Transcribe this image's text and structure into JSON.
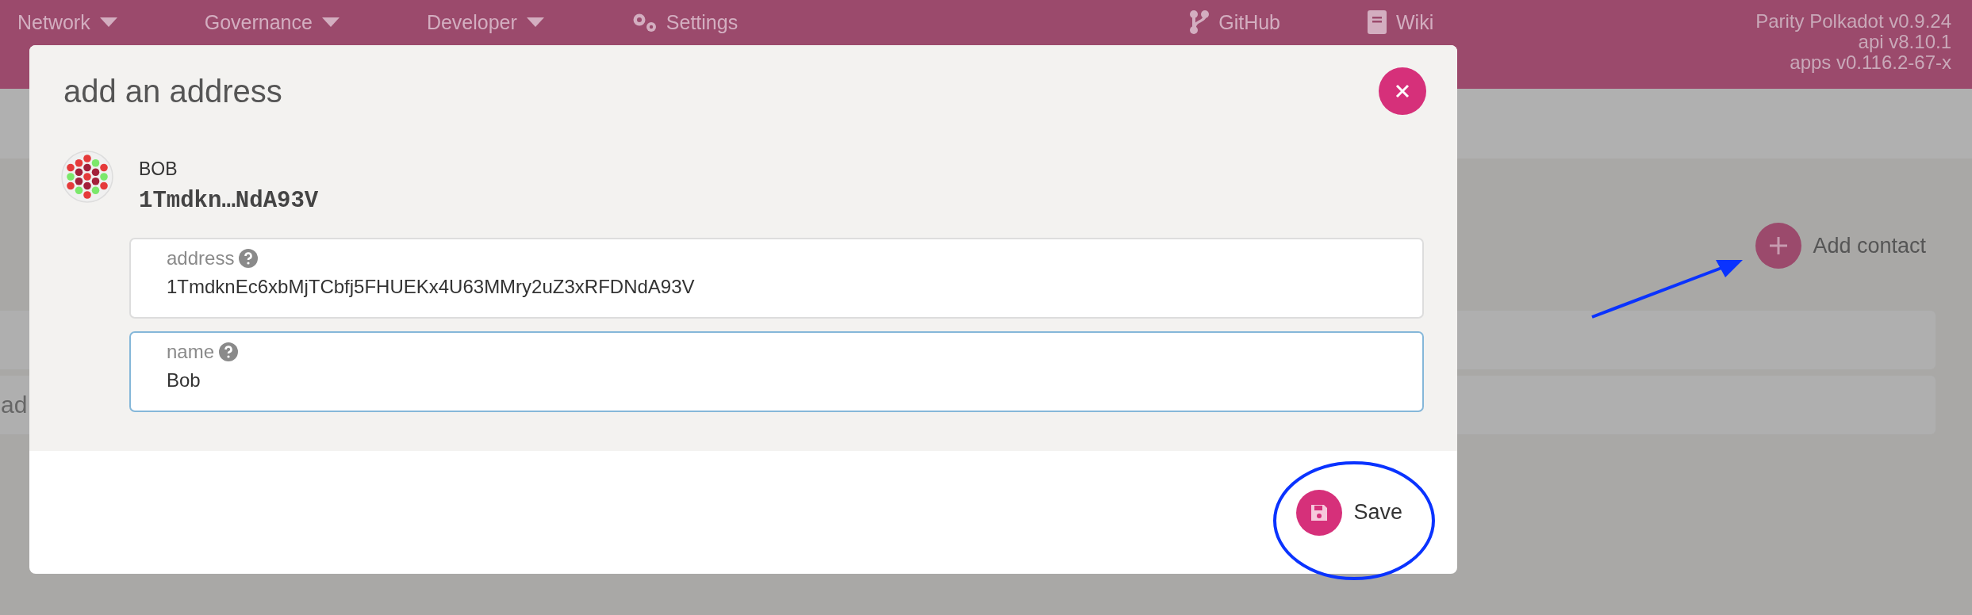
{
  "top_bar": {
    "menus": [
      {
        "label": "Network",
        "kind": "dropdown"
      },
      {
        "label": "Governance",
        "kind": "dropdown"
      },
      {
        "label": "Developer",
        "kind": "dropdown"
      },
      {
        "label": "Settings",
        "kind": "settings"
      },
      {
        "label": "GitHub",
        "kind": "github"
      },
      {
        "label": "Wiki",
        "kind": "wiki"
      }
    ],
    "version": [
      "Parity Polkadot v0.9.24",
      "api v8.10.1",
      "apps v0.116.2-67-x"
    ]
  },
  "page": {
    "add_contact": "Add contact",
    "rows": [
      {
        "kind": "blank"
      },
      {
        "kind": "text",
        "label": "ad"
      }
    ]
  },
  "modal": {
    "title": "add an address",
    "account": {
      "name": "BOB",
      "short_address": "1Tmdkn…NdA93V"
    },
    "fields": [
      {
        "label": "address",
        "value": "1TmdknEc6xbMjTCbfj5FHUEKx4U63MMry2uZ3xRFDNdA93V",
        "focused": false
      },
      {
        "label": "name",
        "value": "Bob",
        "focused": true
      }
    ],
    "save": "Save"
  },
  "annotations": {
    "highlight_circle": true,
    "arrow": true
  }
}
